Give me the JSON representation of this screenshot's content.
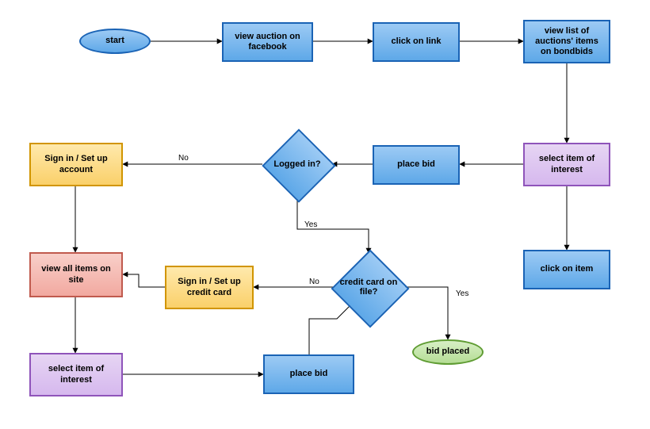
{
  "nodes": {
    "start": "start",
    "view_fb": "view auction on facebook",
    "click_link": "click on link",
    "view_list": "view list of auctions' items on bondbids",
    "select_item_1": "select item of interest",
    "click_item": "click on item",
    "place_bid_1": "place bid",
    "logged_in": "Logged in?",
    "signin_acct": "Sign in / Set up account",
    "view_all": "view all items on site",
    "select_item_2": "select item of interest",
    "place_bid_2": "place bid",
    "cc_file": "credit card on file?",
    "signin_cc": "Sign in / Set up credit card",
    "bid_placed": "bid placed"
  },
  "edges": {
    "logged_no": "No",
    "logged_yes": "Yes",
    "cc_no": "No",
    "cc_yes": "Yes"
  }
}
